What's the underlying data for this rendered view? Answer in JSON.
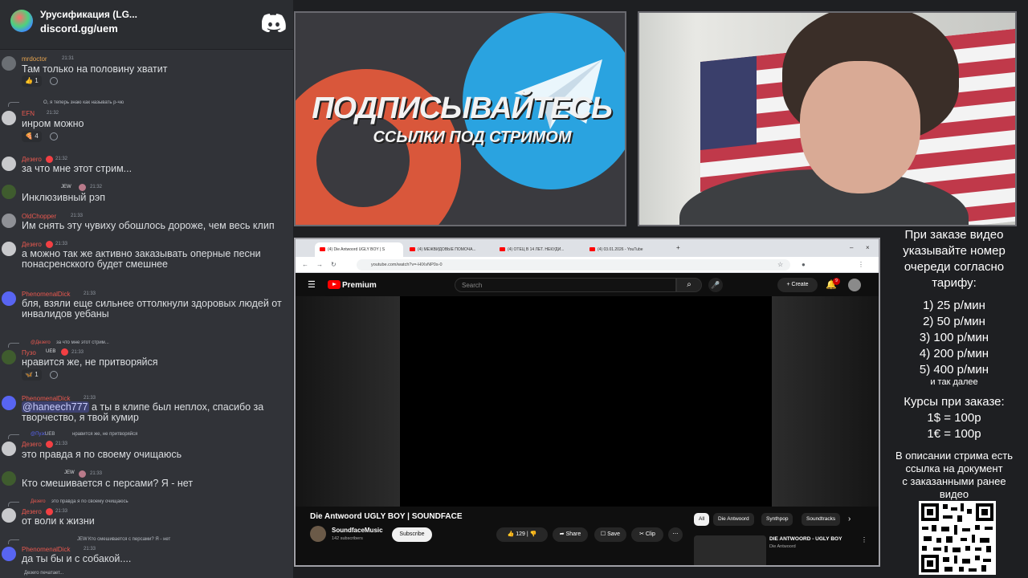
{
  "discord": {
    "server_name": "Урусификация (LG...",
    "server_link": "discord.gg/uem",
    "typing": "Дезеro печатает..."
  },
  "messages": [
    {
      "user": "mrdoctor",
      "time": "21:31",
      "text": "Там только на половину хватит",
      "reaction_count": "1"
    },
    {
      "reply_text": "О, я теперь знаю как называть р-чю",
      "user": "EFN",
      "time": "21:32",
      "text": "инром можно",
      "reaction_count": "4"
    },
    {
      "user": "Дезеro",
      "time": "21:32",
      "text": "за что мне этот стрим..."
    },
    {
      "user": "",
      "tag": "JEW",
      "time": "21:32",
      "text": "Инклюзивный рэп"
    },
    {
      "user": "OldChopper",
      "time": "21:33",
      "text": "Им снять эту чувиху обошлось дороже, чем весь клип"
    },
    {
      "user": "Дезеro",
      "time": "21:33",
      "text": "а можно так же активно заказывать оперные песни понасренсккого будет смешнее"
    },
    {
      "user": "PhenomenalDick",
      "time": "21:33",
      "text": "бля, взяли еще сильнее оттолкнули здоровых людей от инвалидов уебаны"
    },
    {
      "reply_text": "за что мне этот стрим...",
      "reply_user": "@Дезеro",
      "user": "Пузо",
      "tag": "UEB",
      "time": "21:33",
      "text": "нравится же, не притворяйся",
      "reaction_count": "1"
    },
    {
      "user": "PhenomenalDick",
      "time": "21:33",
      "mention": "@haneech777",
      "text": " а ты в клипе был неплох, спасибо за творчество, я твой кумир"
    },
    {
      "reply_text": "нравится же, не притворяйся",
      "reply_user": "@Пузо",
      "reply_tag": "UEB",
      "user": "Дезеro",
      "time": "21:33",
      "text": "это правда я по своему очищаюсь"
    },
    {
      "user": "",
      "tag": "JEW",
      "time": "21:33",
      "text": "Кто смешивается с персами? Я - нет"
    },
    {
      "reply_text": "это правда я по своему очищаюсь",
      "reply_user": "Дезеro",
      "user": "Дезеro",
      "time": "21:33",
      "text": "от воли к жизни"
    },
    {
      "reply_text": "Кто смешивается с персами? Я - нет",
      "reply_tag": "JEW",
      "user": "PhenomenalDick",
      "time": "21:33",
      "text": "да ты бы и с собакой...."
    }
  ],
  "banner": {
    "title": "ПОДПИСЫВАЙТЕСЬ",
    "subtitle": "ССЫЛКИ ПОД СТРИМОМ"
  },
  "browser": {
    "tabs": [
      "(4) Die Antwoord UGLY BOY | S",
      "(4) МЕЖВИДОВЫЕ ПОМОЧА...",
      "(4) ОТЕЦ В 14 ЛЕТ. НЕКУДИ...",
      "(4) 03.01.2026 - YouTube"
    ],
    "url": "youtube.com/watch?v=-HIXvNP0s-0"
  },
  "youtube": {
    "brand": "Premium",
    "search_placeholder": "Search",
    "create_label": "Create",
    "notif_count": "9",
    "video_title": "Die Antwoord UGLY BOY | SOUNDFACE",
    "channel_name": "SoundfaceMusic",
    "channel_subs": "142 subscribers",
    "subscribe_label": "Subscribe",
    "like_count": "129",
    "share_label": "Share",
    "save_label": "Save",
    "clip_label": "Clip",
    "chips": [
      "All",
      "Die Antwoord",
      "Synthpop",
      "Soundtracks"
    ],
    "rec_title": "DIE ANTWOORD - UGLY BOY",
    "rec_channel": "Die Antwoord"
  },
  "info": {
    "heading_1": "При заказе видео",
    "heading_2": "указывайте номер",
    "heading_3": "очереди согласно",
    "heading_4": "тарифу:",
    "tariffs": [
      "1) 25 р/мин",
      "2) 50 р/мин",
      "3) 100 р/мин",
      "4) 200 р/мин",
      "5) 400 р/мин"
    ],
    "tariffs_more": "и так далее",
    "rates_heading": "Курсы при заказе:",
    "rate_usd": "1$ = 100р",
    "rate_eur": "1€ = 100р",
    "desc_1": "В описании стрима есть",
    "desc_2": "ссылка на документ",
    "desc_3": "с заказанными ранее",
    "desc_4": "видео"
  },
  "colors": {
    "discord_bg": "#313338",
    "discord_blurple": "#5865f2",
    "username_red": "#e8584f",
    "username_yellow": "#c9a227",
    "yt_red": "#ff0000",
    "telegram_blue": "#2aa3e0",
    "patreon_orange": "#d9573b"
  }
}
